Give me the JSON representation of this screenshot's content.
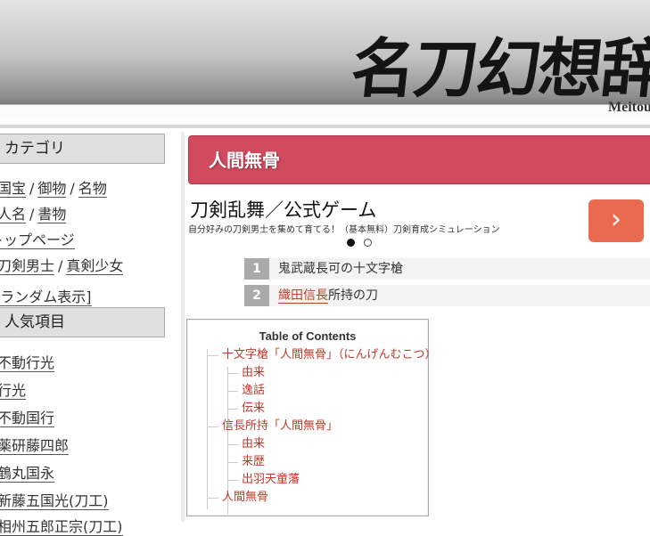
{
  "header": {
    "logo": "名刀幻想辞",
    "subtitle": "Meitou"
  },
  "sidebar": {
    "category_heading": "カテゴリ",
    "category_links": [
      [
        "国宝",
        "御物",
        "名物"
      ],
      [
        "人名",
        "書物"
      ],
      [
        "トップページ"
      ],
      [
        "刀剣男士",
        "真剣少女"
      ],
      [
        "[ランダム表示]"
      ]
    ],
    "popular_heading": "人気項目",
    "popular_links": [
      "不動行光",
      "行光",
      "不動国行",
      "薬研藤四郎",
      "鶴丸国永",
      "新藤五国光(刀工)",
      "相州五郎正宗(刀工)"
    ]
  },
  "main": {
    "article_title": "人間無骨",
    "ad": {
      "title": "刀剣乱舞／公式ゲーム",
      "description": "自分好みの刀剣男士を集めて育てる！（基本無料）刀剣育成シミュレーション",
      "button_glyph": "›"
    },
    "related": [
      {
        "num": "1",
        "text_link": "",
        "text": "鬼武蔵長可の十文字槍"
      },
      {
        "num": "2",
        "text_link": "織田信長",
        "text": "所持の刀"
      }
    ],
    "toc": {
      "title": "Table of Contents",
      "items": [
        {
          "level": 1,
          "label": "十文字槍「人間無骨」（にんげんむこつ）"
        },
        {
          "level": 2,
          "label": "由来"
        },
        {
          "level": 2,
          "label": "逸話"
        },
        {
          "level": 2,
          "label": "伝来"
        },
        {
          "level": 1,
          "label": "信長所持「人間無骨」"
        },
        {
          "level": 2,
          "label": "由来"
        },
        {
          "level": 2,
          "label": "来歴"
        },
        {
          "level": 2,
          "label": "出羽天童藩"
        },
        {
          "level": 1,
          "label": "人間無骨"
        }
      ]
    }
  }
}
